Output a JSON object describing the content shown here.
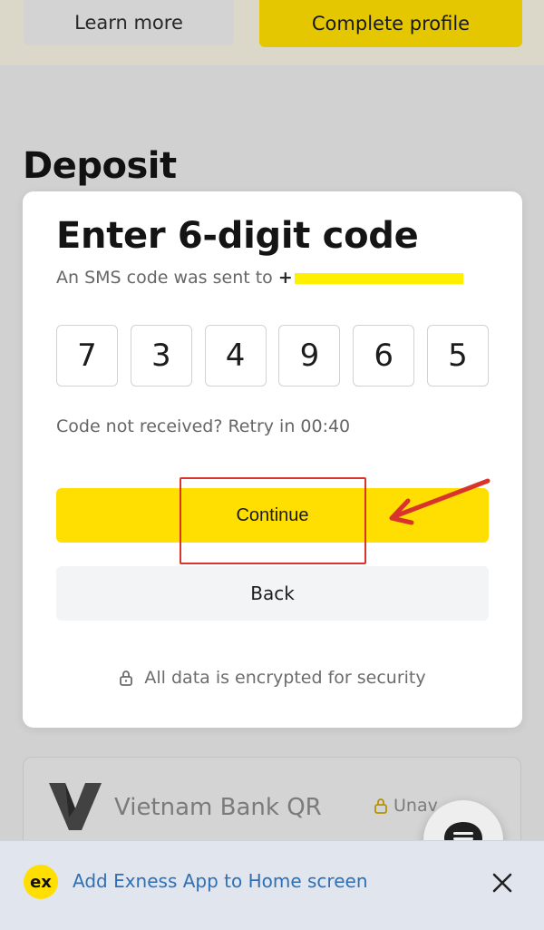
{
  "header": {
    "learn_more_label": "Learn more",
    "complete_profile_label": "Complete profile"
  },
  "page": {
    "title": "Deposit"
  },
  "modal": {
    "title": "Enter 6-digit code",
    "sms_prefix": "An SMS code was sent to",
    "phone_visible_prefix": "+",
    "code_digits": [
      "7",
      "3",
      "4",
      "9",
      "6",
      "5"
    ],
    "retry_text": "Code not received? Retry in 00:40",
    "continue_label": "Continue",
    "back_label": "Back",
    "security_note": "All data is encrypted for security",
    "lock_icon": "lock-icon"
  },
  "payment_method": {
    "name": "Vietnam Bank QR",
    "status": "Unav"
  },
  "install_banner": {
    "logo_text": "ex",
    "text": "Add Exness App to Home screen",
    "close_icon": "close-icon"
  },
  "chat_icon": "chat-icon",
  "colors": {
    "brand_yellow": "#ffde02",
    "annotation_red": "#d9342b",
    "link_blue": "#2f6fb5"
  }
}
